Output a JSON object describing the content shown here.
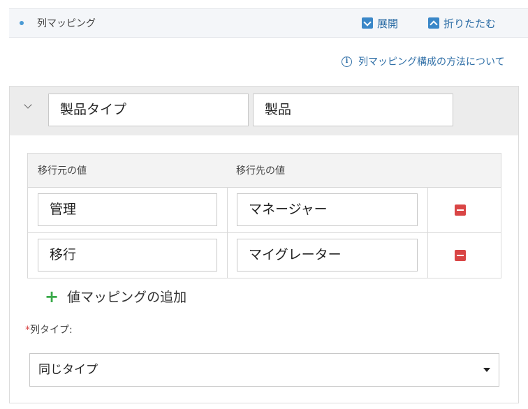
{
  "section": {
    "title": "列マッピング"
  },
  "toolbar": {
    "expand_label": "展開",
    "collapse_label": "折りたたむ"
  },
  "help": {
    "label": "列マッピング構成の方法について"
  },
  "mapping": {
    "source_column": "製品タイプ",
    "target_column": "製品",
    "table": {
      "headers": [
        "移行元の値",
        "移行先の値"
      ],
      "rows": [
        {
          "source": "管理",
          "target": "マネージャー"
        },
        {
          "source": "移行",
          "target": "マイグレーター"
        }
      ]
    },
    "add_label": "値マッピングの追加",
    "column_type": {
      "required_mark": "*",
      "label": "列タイプ:",
      "value": "同じタイプ"
    }
  },
  "colors": {
    "accent": "#3a87c8",
    "delete": "#d94545",
    "add": "#3aaa4a"
  },
  "icons": {
    "expand": "chevron-down-icon",
    "collapse": "chevron-up-icon",
    "info": "info-icon",
    "delete": "minus-icon",
    "add": "plus-icon"
  }
}
